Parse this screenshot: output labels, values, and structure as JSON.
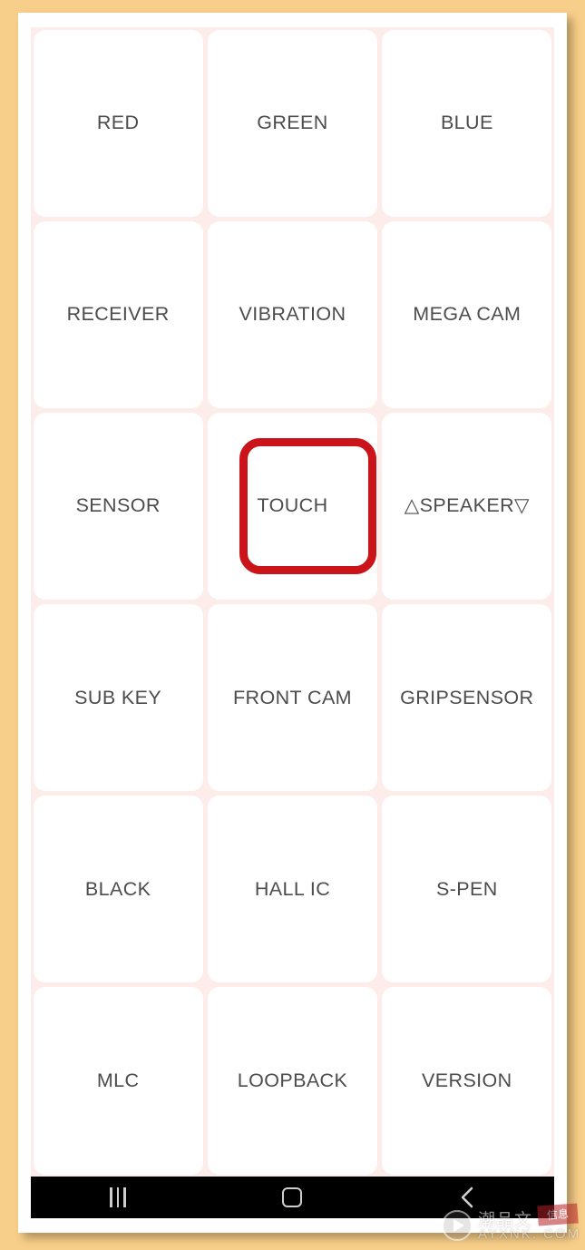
{
  "theme": {
    "page_background": "#f8cf8a",
    "frame_background": "#ffffff",
    "screen_background": "#fdf2f0",
    "grid_gap_color": "#fcecea",
    "cell_background": "#ffffff",
    "label_color": "#4c4c4c",
    "annotation_color": "#cb1419",
    "navbar_background": "#000000",
    "navbar_icon_color": "#cfcfcf"
  },
  "screen": {
    "app_kind": "hardware-test-grid",
    "grid": {
      "columns": 3,
      "rows": 6,
      "cells": [
        {
          "label": "RED",
          "highlighted": false
        },
        {
          "label": "GREEN",
          "highlighted": false
        },
        {
          "label": "BLUE",
          "highlighted": false
        },
        {
          "label": "RECEIVER",
          "highlighted": false
        },
        {
          "label": "VIBRATION",
          "highlighted": false
        },
        {
          "label": "MEGA CAM",
          "highlighted": false
        },
        {
          "label": "SENSOR",
          "highlighted": false
        },
        {
          "label": "TOUCH",
          "highlighted": true
        },
        {
          "label": "△SPEAKER▽",
          "highlighted": false
        },
        {
          "label": "SUB KEY",
          "highlighted": false
        },
        {
          "label": "FRONT CAM",
          "highlighted": false
        },
        {
          "label": "GRIPSENSOR",
          "highlighted": false
        },
        {
          "label": "BLACK",
          "highlighted": false
        },
        {
          "label": "HALL IC",
          "highlighted": false
        },
        {
          "label": "S-PEN",
          "highlighted": false
        },
        {
          "label": "MLC",
          "highlighted": false
        },
        {
          "label": "LOOPBACK",
          "highlighted": false
        },
        {
          "label": "VERSION",
          "highlighted": false
        }
      ]
    },
    "annotation": {
      "target_label": "TOUCH",
      "shape": "rounded-rectangle-outline",
      "color": "#cb1419"
    }
  },
  "navbar": {
    "buttons": [
      {
        "icon": "recents-icon",
        "label": "Recents"
      },
      {
        "icon": "home-icon",
        "label": "Home"
      },
      {
        "icon": "back-icon",
        "label": "Back"
      }
    ]
  },
  "watermark": {
    "play_icon": "play-circle-icon",
    "chinese_text": "潮品文",
    "stamp_text": "信息",
    "url_text": "AYXNK. COM"
  }
}
